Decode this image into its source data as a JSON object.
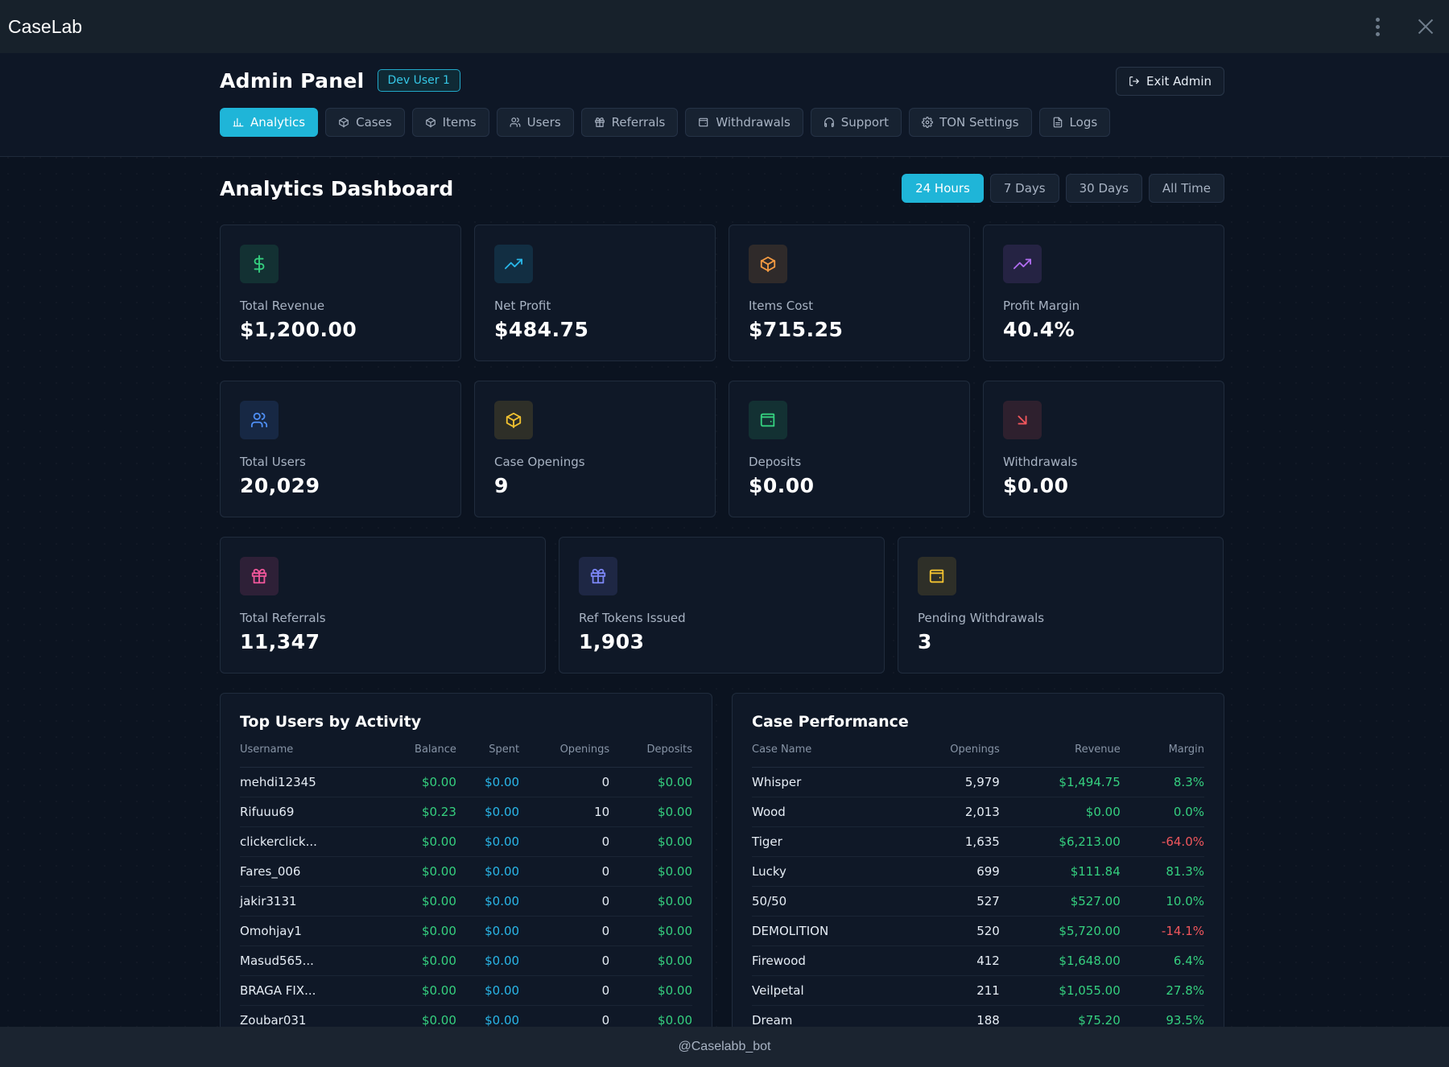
{
  "window": {
    "title": "CaseLab"
  },
  "header": {
    "title": "Admin Panel",
    "badge": "Dev User 1",
    "exit_label": "Exit Admin"
  },
  "tabs": [
    {
      "label": "Analytics",
      "icon": "bar-chart-icon",
      "active": true
    },
    {
      "label": "Cases",
      "icon": "box-icon"
    },
    {
      "label": "Items",
      "icon": "box-icon"
    },
    {
      "label": "Users",
      "icon": "users-icon"
    },
    {
      "label": "Referrals",
      "icon": "gift-icon"
    },
    {
      "label": "Withdrawals",
      "icon": "wallet-icon"
    },
    {
      "label": "Support",
      "icon": "headphones-icon"
    },
    {
      "label": "TON Settings",
      "icon": "gear-icon"
    },
    {
      "label": "Logs",
      "icon": "file-icon"
    }
  ],
  "dashboard": {
    "title": "Analytics Dashboard",
    "ranges": [
      "24 Hours",
      "7 Days",
      "30 Days",
      "All Time"
    ],
    "active_range": "24 Hours"
  },
  "stats_row1": [
    {
      "label": "Total Revenue",
      "value": "$1,200.00",
      "icon": "dollar-icon",
      "color": "#35d07f"
    },
    {
      "label": "Net Profit",
      "value": "$484.75",
      "icon": "trending-up-icon",
      "color": "#29b6e8"
    },
    {
      "label": "Items Cost",
      "value": "$715.25",
      "icon": "box-icon",
      "color": "#f59b42"
    },
    {
      "label": "Profit Margin",
      "value": "40.4%",
      "icon": "trending-up-icon",
      "color": "#b06cf0"
    }
  ],
  "stats_row2": [
    {
      "label": "Total Users",
      "value": "20,029",
      "icon": "users-icon",
      "color": "#4f8ff5"
    },
    {
      "label": "Case Openings",
      "value": "9",
      "icon": "box-icon",
      "color": "#f2c230"
    },
    {
      "label": "Deposits",
      "value": "$0.00",
      "icon": "wallet-icon",
      "color": "#35d07f"
    },
    {
      "label": "Withdrawals",
      "value": "$0.00",
      "icon": "arrow-down-right-icon",
      "color": "#f0565c"
    }
  ],
  "stats_row3": [
    {
      "label": "Total Referrals",
      "value": "11,347",
      "icon": "gift-icon",
      "color": "#f0569a"
    },
    {
      "label": "Ref Tokens Issued",
      "value": "1,903",
      "icon": "gift-icon",
      "color": "#7c86f5"
    },
    {
      "label": "Pending Withdrawals",
      "value": "3",
      "icon": "wallet-icon",
      "color": "#f2c230"
    }
  ],
  "top_users": {
    "title": "Top Users by Activity",
    "columns": [
      "Username",
      "Balance",
      "Spent",
      "Openings",
      "Deposits"
    ],
    "rows": [
      [
        "mehdi12345",
        "$0.00",
        "$0.00",
        "0",
        "$0.00"
      ],
      [
        "Rifuuu69",
        "$0.23",
        "$0.00",
        "10",
        "$0.00"
      ],
      [
        "clickerclick...",
        "$0.00",
        "$0.00",
        "0",
        "$0.00"
      ],
      [
        "Fares_006",
        "$0.00",
        "$0.00",
        "0",
        "$0.00"
      ],
      [
        "jakir3131",
        "$0.00",
        "$0.00",
        "0",
        "$0.00"
      ],
      [
        "Omohjay1",
        "$0.00",
        "$0.00",
        "0",
        "$0.00"
      ],
      [
        "Masud565...",
        "$0.00",
        "$0.00",
        "0",
        "$0.00"
      ],
      [
        "BRAGA FIX...",
        "$0.00",
        "$0.00",
        "0",
        "$0.00"
      ],
      [
        "Zoubar031",
        "$0.00",
        "$0.00",
        "0",
        "$0.00"
      ]
    ]
  },
  "case_performance": {
    "title": "Case Performance",
    "columns": [
      "Case Name",
      "Openings",
      "Revenue",
      "Margin"
    ],
    "rows": [
      [
        "Whisper",
        "5,979",
        "$1,494.75",
        "8.3%"
      ],
      [
        "Wood",
        "2,013",
        "$0.00",
        "0.0%"
      ],
      [
        "Tiger",
        "1,635",
        "$6,213.00",
        "-64.0%"
      ],
      [
        "Lucky",
        "699",
        "$111.84",
        "81.3%"
      ],
      [
        "50/50",
        "527",
        "$527.00",
        "10.0%"
      ],
      [
        "DEMOLITION",
        "520",
        "$5,720.00",
        "-14.1%"
      ],
      [
        "Firewood",
        "412",
        "$1,648.00",
        "6.4%"
      ],
      [
        "Veilpetal",
        "211",
        "$1,055.00",
        "27.8%"
      ],
      [
        "Dream",
        "188",
        "$75.20",
        "93.5%"
      ]
    ]
  },
  "footer": {
    "text": "@Caselabb_bot"
  }
}
